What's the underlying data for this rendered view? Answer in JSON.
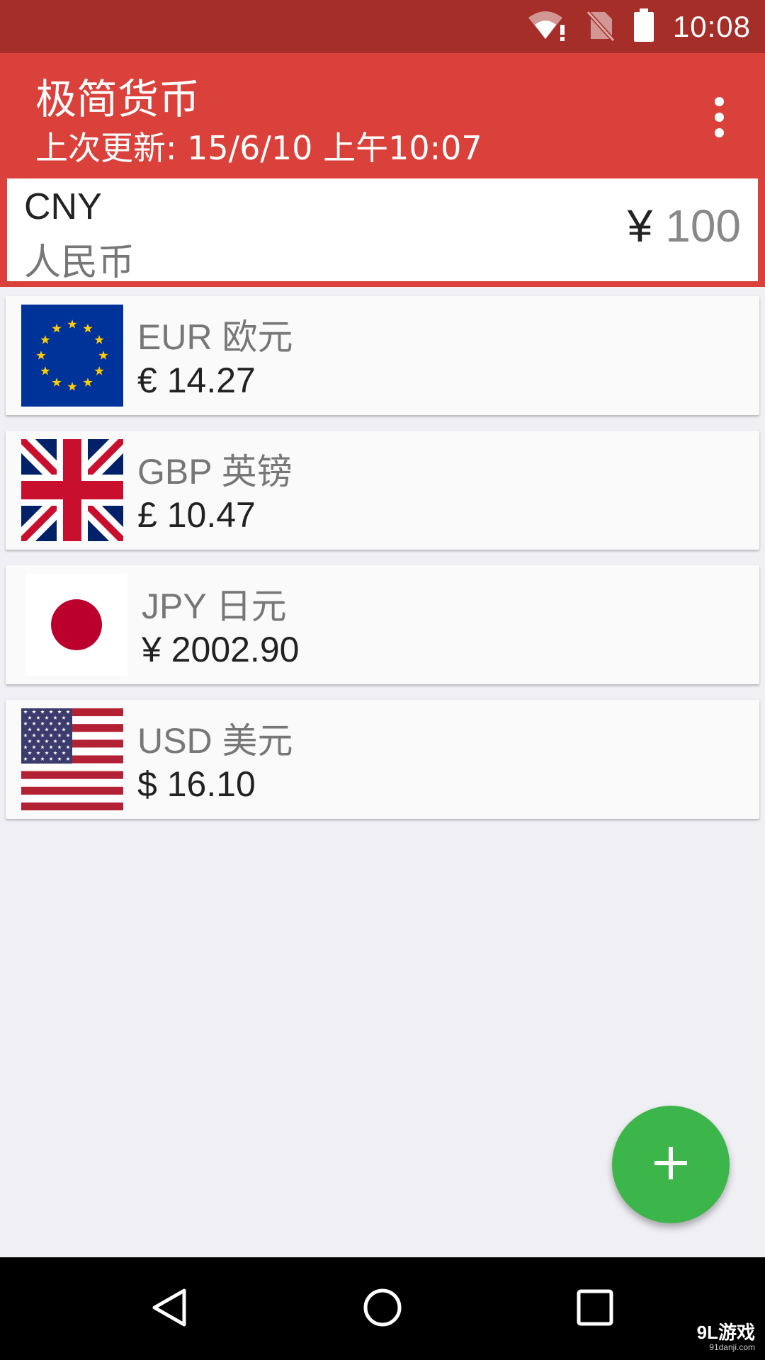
{
  "status_bar": {
    "time": "10:08",
    "icons": [
      "wifi-alert-icon",
      "no-sim-icon",
      "battery-icon"
    ]
  },
  "app_bar": {
    "title": "极简货币",
    "subtitle": "上次更新: 15/6/10 上午10:07",
    "menu_icon": "more-vert-icon"
  },
  "base_currency": {
    "code": "CNY",
    "name": "人民币",
    "symbol": "¥",
    "amount": "100"
  },
  "currencies": [
    {
      "title": "EUR 欧元",
      "value": "€ 14.27",
      "flag": "eu-flag-icon"
    },
    {
      "title": "GBP 英镑",
      "value": "£ 10.47",
      "flag": "uk-flag-icon"
    },
    {
      "title": "JPY 日元",
      "value": "¥ 2002.90",
      "flag": "japan-flag-icon"
    },
    {
      "title": "USD 美元",
      "value": "$ 16.10",
      "flag": "us-flag-icon"
    }
  ],
  "fab": {
    "icon": "plus-icon"
  },
  "nav_bar": {
    "icons": [
      "back-icon",
      "home-icon",
      "recents-icon"
    ]
  },
  "watermark": {
    "brand": "9L游戏",
    "site": "91danji.com"
  },
  "colors": {
    "status_bar": "#A52E29",
    "app_bar": "#DA413B",
    "fab": "#3CB54A",
    "background": "#EFEFF4"
  }
}
